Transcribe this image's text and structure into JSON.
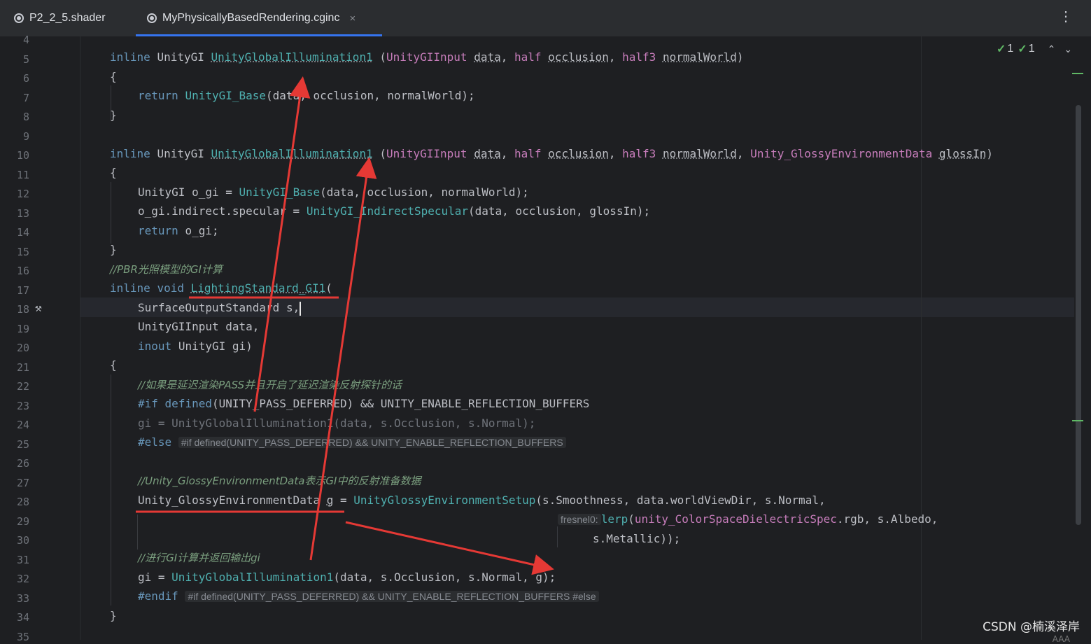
{
  "tabs": [
    {
      "label": "P2_2_5.shader",
      "icon": "shader-file-icon",
      "active": false
    },
    {
      "label": "MyPhysicallyBasedRendering.cginc",
      "icon": "shader-file-icon",
      "active": true,
      "close": "×"
    }
  ],
  "menu_icon": "⋮",
  "inspection": {
    "ok_count": "1",
    "warn_count": "1"
  },
  "line_numbers": [
    "4",
    "5",
    "6",
    "7",
    "8",
    "9",
    "10",
    "11",
    "12",
    "13",
    "14",
    "15",
    "16",
    "17",
    "18",
    "19",
    "20",
    "21",
    "22",
    "23",
    "24",
    "25",
    "26",
    "27",
    "28",
    "29",
    "30",
    "31",
    "32",
    "33",
    "34",
    "35"
  ],
  "code": {
    "l5": {
      "kw": "inline",
      "ret": "UnityGI",
      "fn": "UnityGlobalIllumination1",
      "p1t": "UnityGIInput",
      "p1": "data",
      "p2t": "half",
      "p2": "occlusion",
      "p3t": "half3",
      "p3": "normalWorld"
    },
    "l6": "{",
    "l7": {
      "kw": "return",
      "fn": "UnityGI_Base",
      "args": "(data, occlusion, normalWorld);"
    },
    "l8": "}",
    "l10": {
      "kw": "inline",
      "ret": "UnityGI",
      "fn": "UnityGlobalIllumination1",
      "p1t": "UnityGIInput",
      "p1": "data",
      "p2t": "half",
      "p2": "occlusion",
      "p3t": "half3",
      "p3": "normalWorld",
      "p4t": "Unity_GlossyEnvironmentData",
      "p4": "glossIn"
    },
    "l11": "{",
    "l12": {
      "t": "UnityGI",
      "v": "o_gi",
      "fn": "UnityGI_Base",
      "args": "(data, occlusion, normalWorld);"
    },
    "l13": {
      "lhs": "o_gi.indirect.specular",
      "fn": "UnityGI_IndirectSpecular",
      "args": "(data, occlusion, glossIn);"
    },
    "l14": {
      "kw": "return",
      "rest": "o_gi;"
    },
    "l15": "}",
    "l16": "//PBR光照模型的GI计算",
    "l17": {
      "kw": "inline",
      "kw2": "void",
      "fn": "LightingStandard_GI1",
      "rest": "("
    },
    "l18": {
      "t": "SurfaceOutputStandard",
      "v": "s,"
    },
    "l19": {
      "t": "UnityGIInput",
      "v": "data,"
    },
    "l20": {
      "kw": "inout",
      "t": "UnityGI",
      "v": "gi)"
    },
    "l21": "{",
    "l22": "//如果是延迟渲染PASS并且开启了延迟渲染反射探针的话",
    "l23": {
      "kw": "#if",
      "kw2": "defined",
      "rest": "(UNITY_PASS_DEFERRED) && UNITY_ENABLE_REFLECTION_BUFFERS"
    },
    "l24": "gi = UnityGlobalIllumination1(data, s.Occlusion, s.Normal);",
    "l25": {
      "kw": "#else",
      "hint": "#if defined(UNITY_PASS_DEFERRED) && UNITY_ENABLE_REFLECTION_BUFFERS"
    },
    "l27": "//Unity_GlossyEnvironmentData表示GI中的反射准备数据",
    "l28": {
      "t": "Unity_GlossyEnvironmentData",
      "v": "g",
      "fn": "UnityGlossyEnvironmentSetup",
      "args": "(s.Smoothness, data.worldViewDir, s.Normal,"
    },
    "l29": {
      "hint": "fresnel0:",
      "fn": "lerp",
      "open": "(",
      "c": "unity_ColorSpaceDielectricSpec",
      "rest": ".rgb, s.Albedo,"
    },
    "l30": "s.Metallic));",
    "l31": "//进行GI计算并返回输出gi",
    "l32": {
      "lhs": "gi = ",
      "fn": "UnityGlobalIllumination1",
      "args": "(data, s.Occlusion, s.Normal, g);"
    },
    "l33": {
      "kw": "#endif",
      "hint": "#if defined(UNITY_PASS_DEFERRED) && UNITY_ENABLE_REFLECTION_BUFFERS #else"
    },
    "l34": "}"
  },
  "watermark": "CSDN @楠溪泽岸",
  "watermark_sub": "AAA",
  "colors": {
    "accent": "#3574f0",
    "annotation": "#e53935",
    "ok": "#5fb865"
  }
}
